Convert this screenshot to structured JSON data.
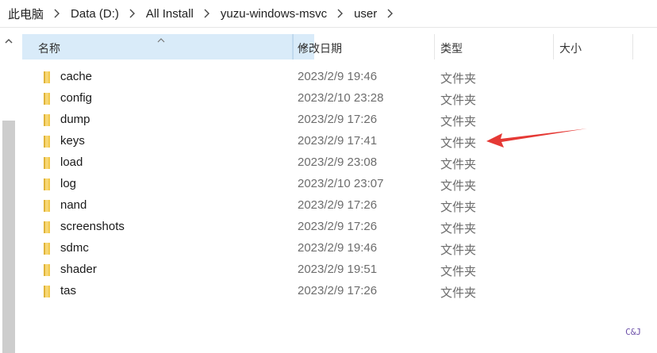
{
  "breadcrumb": {
    "items": [
      "此电脑",
      "Data (D:)",
      "All Install",
      "yuzu-windows-msvc",
      "user"
    ]
  },
  "columns": {
    "name": "名称",
    "date": "修改日期",
    "type": "类型",
    "size": "大小"
  },
  "files": [
    {
      "name": "cache",
      "date": "2023/2/9 19:46",
      "type": "文件夹"
    },
    {
      "name": "config",
      "date": "2023/2/10 23:28",
      "type": "文件夹"
    },
    {
      "name": "dump",
      "date": "2023/2/9 17:26",
      "type": "文件夹"
    },
    {
      "name": "keys",
      "date": "2023/2/9 17:41",
      "type": "文件夹"
    },
    {
      "name": "load",
      "date": "2023/2/9 23:08",
      "type": "文件夹"
    },
    {
      "name": "log",
      "date": "2023/2/10 23:07",
      "type": "文件夹"
    },
    {
      "name": "nand",
      "date": "2023/2/9 17:26",
      "type": "文件夹"
    },
    {
      "name": "screenshots",
      "date": "2023/2/9 17:26",
      "type": "文件夹"
    },
    {
      "name": "sdmc",
      "date": "2023/2/9 19:46",
      "type": "文件夹"
    },
    {
      "name": "shader",
      "date": "2023/2/9 19:51",
      "type": "文件夹"
    },
    {
      "name": "tas",
      "date": "2023/2/9 17:26",
      "type": "文件夹"
    }
  ],
  "watermark": "C&J",
  "colors": {
    "header_highlight": "#d9ebf9",
    "folder": "#f2c94c",
    "annotation_arrow": "#e53935"
  },
  "icons": {
    "folder": "folder-icon",
    "sort": "sort-ascending-icon",
    "dropdown": "chevron-down-icon",
    "breadcrumb_separator": "chevron-right-icon",
    "scroll_up": "scroll-up-icon"
  }
}
